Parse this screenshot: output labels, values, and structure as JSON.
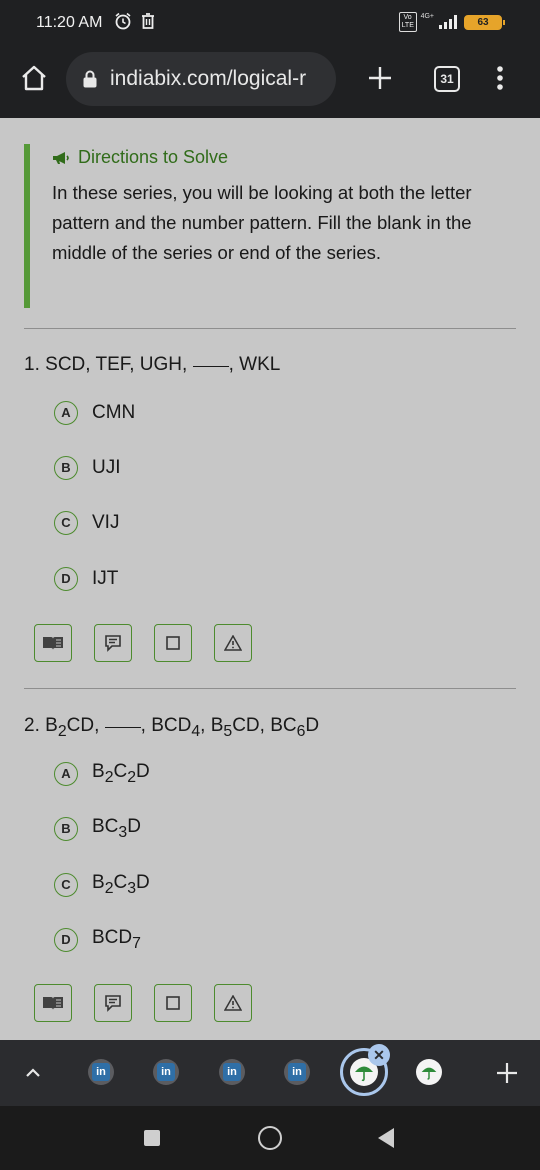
{
  "status_bar": {
    "time": "11:20 AM",
    "volte": "Vo LTE",
    "network": "4G+",
    "battery": "63"
  },
  "browser": {
    "url": "indiabix.com/logical-r",
    "tab_count": "31"
  },
  "directions": {
    "title": "Directions to Solve",
    "text": "In these series, you will be looking at both the letter pattern and the number pattern. Fill the blank in the middle of the series or end of the series."
  },
  "questions": [
    {
      "number": "1.",
      "before": "SCD, TEF, UGH,",
      "after": ", WKL",
      "options": [
        {
          "letter": "A",
          "text": "CMN"
        },
        {
          "letter": "B",
          "text": "UJI"
        },
        {
          "letter": "C",
          "text": "VIJ"
        },
        {
          "letter": "D",
          "text": "IJT"
        }
      ]
    },
    {
      "number": "2.",
      "options": [
        {
          "letter": "A"
        },
        {
          "letter": "B"
        },
        {
          "letter": "C"
        },
        {
          "letter": "D"
        }
      ]
    }
  ],
  "q2_parts": {
    "b1": "B",
    "b1_sub": "2",
    "b1_rest": "CD,",
    "after1": ", BCD",
    "after1_sub": "4",
    "after2": ", B",
    "after2_sub": "5",
    "after2_rest": "CD, BC",
    "after3_sub": "6",
    "after3_rest": "D",
    "optA_1": "B",
    "optA_s1": "2",
    "optA_2": "C",
    "optA_s2": "2",
    "optA_3": "D",
    "optB_1": "BC",
    "optB_s1": "3",
    "optB_2": "D",
    "optC_1": "B",
    "optC_s1": "2",
    "optC_2": "C",
    "optC_s2": "3",
    "optC_3": "D",
    "optD_1": "BCD",
    "optD_s1": "7"
  },
  "icons": {
    "tools": [
      "book-icon",
      "comment-icon",
      "square-icon",
      "warning-icon"
    ],
    "accent": "#63b33c",
    "title_green": "#3f8b22"
  }
}
